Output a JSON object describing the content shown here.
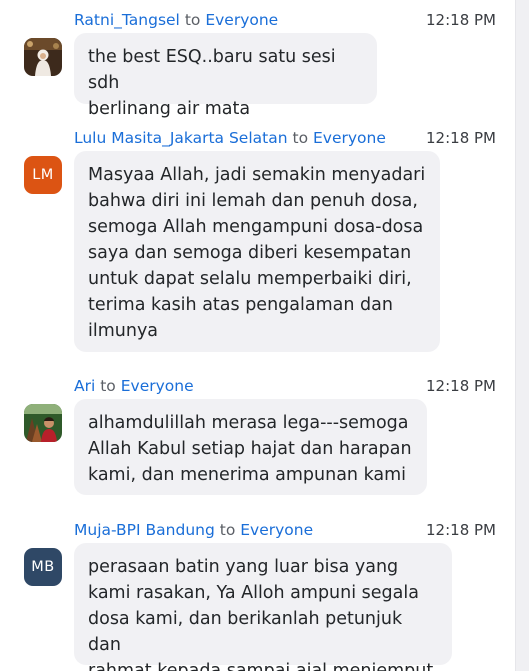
{
  "messages": [
    {
      "sender": "Ratni_Tangsel",
      "to_word": "to",
      "recipient": "Everyone",
      "time": "12:18 PM",
      "avatar": {
        "type": "photo"
      },
      "text": "the best ESQ..baru satu sesi sdh\nberlinang air mata"
    },
    {
      "sender": "Lulu Masita_Jakarta Selatan",
      "to_word": "to",
      "recipient": "Everyone",
      "time": "12:18 PM",
      "avatar": {
        "type": "initials",
        "initials": "LM",
        "color": "#dc5413"
      },
      "text": "Masyaa Allah, jadi semakin menyadari\nbahwa diri ini lemah dan penuh dosa,\nsemoga Allah mengampuni dosa-dosa\nsaya dan semoga diberi kesempatan\nuntuk dapat selalu memperbaiki diri,\nterima kasih atas pengalaman dan\nilmunya"
    },
    {
      "sender": "Ari",
      "to_word": "to",
      "recipient": "Everyone",
      "time": "12:18 PM",
      "avatar": {
        "type": "photo"
      },
      "text": "alhamdulillah merasa lega---semoga\nAllah Kabul setiap hajat dan harapan\nkami, dan menerima ampunan kami"
    },
    {
      "sender": "Muja-BPI Bandung",
      "to_word": "to",
      "recipient": "Everyone",
      "time": "12:18 PM",
      "avatar": {
        "type": "initials",
        "initials": "MB",
        "color": "#2f4866"
      },
      "text": "perasaan batin yang luar bisa yang\nkami rasakan, Ya Alloh ampuni segala\ndosa kami, dan berikanlah petunjuk dan\nrahmat kepada sampai ajal menjemput"
    }
  ]
}
